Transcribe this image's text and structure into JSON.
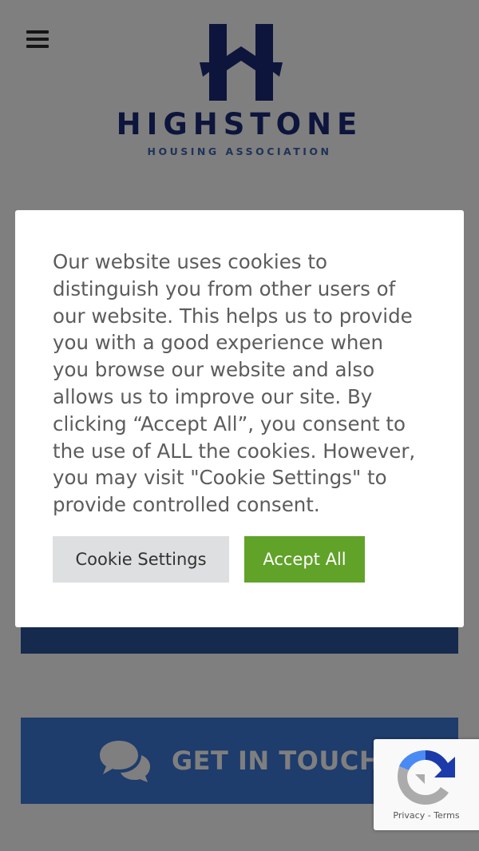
{
  "header": {
    "menu_icon": "hamburger-menu-icon",
    "logo": {
      "name": "HIGHSTONE",
      "tagline": "HOUSING ASSOCIATION",
      "brand_color": "#1b2a78",
      "tagline_color": "#3f66b0"
    }
  },
  "cta": {
    "top_color": "#2a5599",
    "bottom": {
      "label": "GET IN TOUCH",
      "icon": "chat-bubbles-icon",
      "color": "#3c78d8"
    }
  },
  "cookie_banner": {
    "message": "Our website uses cookies to\ndistinguish you from other users of\nour website. This helps us to provide\nyou with a good experience when\nyou browse our website and also\nallows us to improve our site. By\nclicking “Accept All”, you consent to\nthe use of ALL the cookies. However,\nyou may visit \"Cookie Settings\" to\nprovide controlled consent.",
    "settings_label": "Cookie Settings",
    "accept_label": "Accept All",
    "accept_color": "#61a229",
    "settings_color": "#dedfe0"
  },
  "recaptcha": {
    "icon": "recaptcha-icon",
    "privacy_label": "Privacy",
    "separator": " - ",
    "terms_label": "Terms"
  }
}
